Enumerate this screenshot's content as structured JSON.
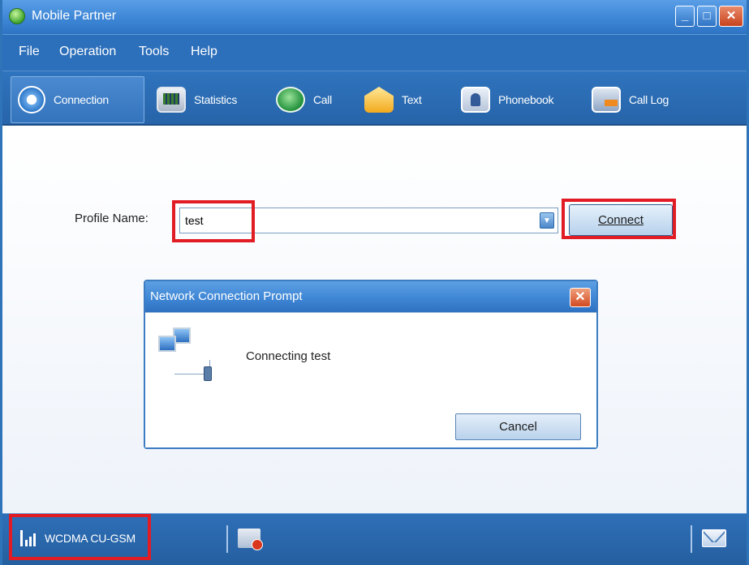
{
  "window": {
    "title": "Mobile Partner",
    "minimize_glyph": "_",
    "maximize_glyph": "□",
    "close_glyph": "✕"
  },
  "menu": [
    {
      "label": "File"
    },
    {
      "label": "Operation"
    },
    {
      "label": "Tools"
    },
    {
      "label": "Help"
    }
  ],
  "toolbar": [
    {
      "label": "Connection",
      "icon": "connection-icon",
      "active": true
    },
    {
      "label": "Statistics",
      "icon": "statistics-icon"
    },
    {
      "label": "Call",
      "icon": "call-icon"
    },
    {
      "label": "Text",
      "icon": "text-message-icon"
    },
    {
      "label": "Phonebook",
      "icon": "phonebook-icon"
    },
    {
      "label": "Call Log",
      "icon": "call-log-icon"
    }
  ],
  "connection": {
    "profile_label": "Profile Name:",
    "profile_value": "test",
    "dropdown_glyph": "▼",
    "connect_label": "Connect"
  },
  "dialog": {
    "title": "Network Connection Prompt",
    "close_glyph": "✕",
    "message": "Connecting test",
    "cancel_label": "Cancel"
  },
  "status": {
    "network": "WCDMA  CU-GSM"
  },
  "colors": {
    "titlebar": "#3d86d6",
    "menubar": "#2c6fba",
    "highlight": "#e21c24"
  }
}
